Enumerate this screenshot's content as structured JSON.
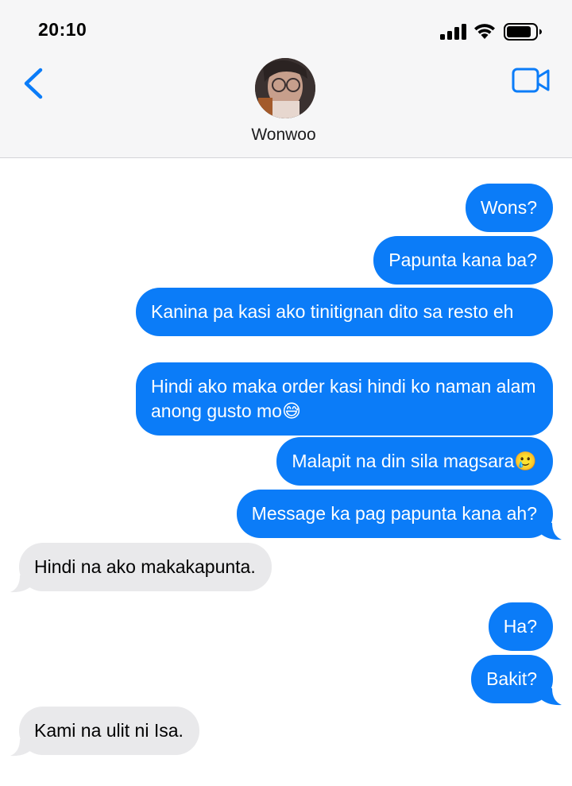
{
  "status_bar": {
    "time": "20:10",
    "icons": [
      "signal-icon",
      "wifi-icon",
      "battery-icon"
    ]
  },
  "header": {
    "contact_name": "Wonwoo",
    "back_icon": "chevron-left-icon",
    "video_icon": "video-camera-icon"
  },
  "colors": {
    "accent": "#0b7cf8",
    "sent_bubble": "#0b7cf8",
    "received_bubble": "#e9e9eb",
    "header_bg": "#f6f6f7"
  },
  "messages": [
    {
      "direction": "sent",
      "text": "Wons?"
    },
    {
      "direction": "sent",
      "text": "Papunta kana ba?"
    },
    {
      "direction": "sent",
      "text": "Kanina pa kasi ako tinitignan dito sa resto eh"
    },
    {
      "direction": "sent",
      "text": "Hindi ako maka order kasi hindi ko naman alam anong gusto mo😅"
    },
    {
      "direction": "sent",
      "text": "Malapit na din sila magsara🥲"
    },
    {
      "direction": "sent",
      "text": "Message ka pag papunta kana ah?"
    },
    {
      "direction": "received",
      "text": "Hindi na ako makakapunta."
    },
    {
      "direction": "sent",
      "text": "Ha?"
    },
    {
      "direction": "sent",
      "text": "Bakit?"
    },
    {
      "direction": "received",
      "text": "Kami na ulit ni Isa."
    }
  ]
}
